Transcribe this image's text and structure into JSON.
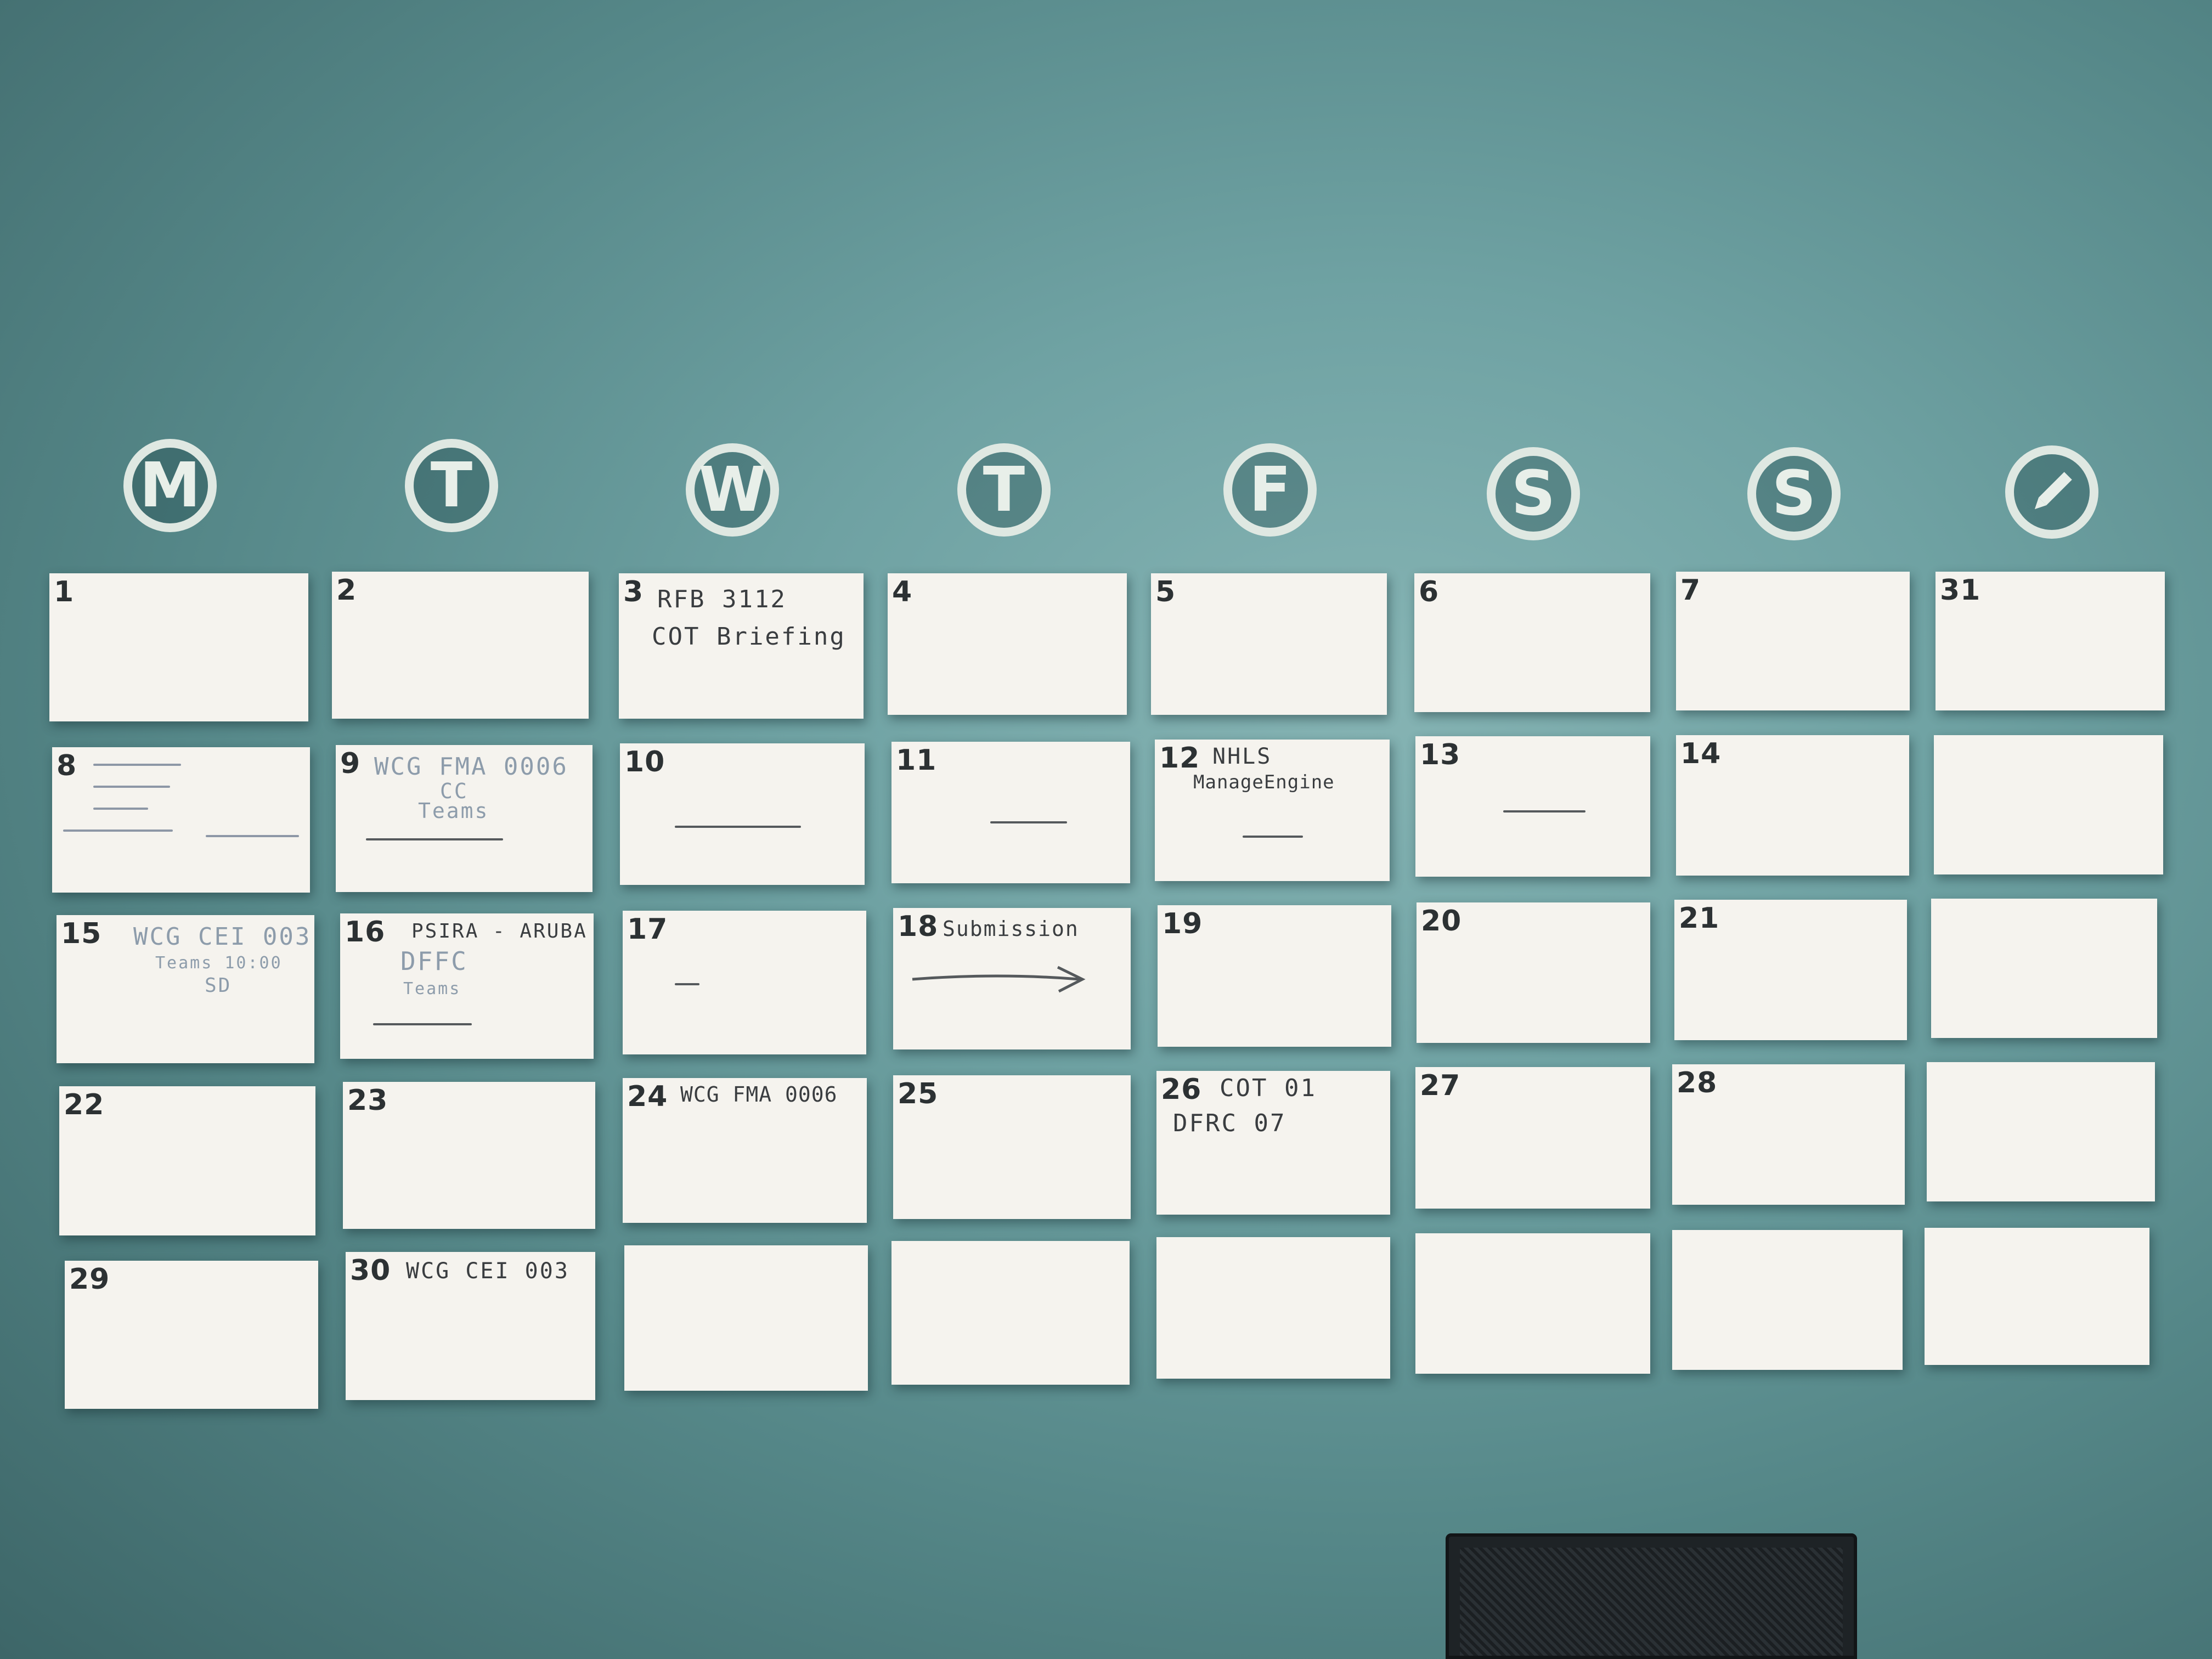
{
  "colors": {
    "wall": "#6fa2a3",
    "card": "#f5f3ee",
    "icon_ring": "#dfe8e2",
    "ink": "#3a3d40"
  },
  "day_headers": [
    {
      "label": "M"
    },
    {
      "label": "T"
    },
    {
      "label": "W"
    },
    {
      "label": "T"
    },
    {
      "label": "F"
    },
    {
      "label": "S"
    },
    {
      "label": "S"
    },
    {
      "icon": "pencil-icon"
    }
  ],
  "weeks": [
    {
      "days": [
        {
          "number": "1"
        },
        {
          "number": "2"
        },
        {
          "number": "3",
          "notes": [
            "RFB 3112",
            "COT Briefing"
          ]
        },
        {
          "number": "4"
        },
        {
          "number": "5"
        },
        {
          "number": "6"
        },
        {
          "number": "7"
        }
      ],
      "notes_card": {
        "number": "31"
      }
    },
    {
      "days": [
        {
          "number": "8"
        },
        {
          "number": "9",
          "notes": [
            "WCG FMA 0006",
            "CC",
            "Teams"
          ]
        },
        {
          "number": "10"
        },
        {
          "number": "11"
        },
        {
          "number": "12",
          "notes": [
            "NHLS",
            "ManageEngine"
          ]
        },
        {
          "number": "13"
        },
        {
          "number": "14"
        }
      ],
      "notes_card": {
        "number": ""
      }
    },
    {
      "days": [
        {
          "number": "15",
          "notes": [
            "WCG CEI 003",
            "Teams 10:00",
            "SD"
          ]
        },
        {
          "number": "16",
          "notes": [
            "PSIRA - ARUBA",
            "DFFC",
            "Teams"
          ]
        },
        {
          "number": "17"
        },
        {
          "number": "18",
          "notes": [
            "Submission"
          ]
        },
        {
          "number": "19"
        },
        {
          "number": "20"
        },
        {
          "number": "21"
        }
      ],
      "notes_card": {
        "number": ""
      }
    },
    {
      "days": [
        {
          "number": "22"
        },
        {
          "number": "23"
        },
        {
          "number": "24",
          "notes": [
            "WCG FMA 0006"
          ]
        },
        {
          "number": "25"
        },
        {
          "number": "26",
          "notes": [
            "COT 01",
            "DFRC 07"
          ]
        },
        {
          "number": "27"
        },
        {
          "number": "28"
        }
      ],
      "notes_card": {
        "number": ""
      }
    },
    {
      "days": [
        {
          "number": "29"
        },
        {
          "number": "30",
          "notes": [
            "WCG CEI 003"
          ]
        },
        {
          "number": ""
        },
        {
          "number": ""
        },
        {
          "number": ""
        },
        {
          "number": ""
        },
        {
          "number": ""
        }
      ],
      "notes_card": {
        "number": ""
      }
    }
  ]
}
